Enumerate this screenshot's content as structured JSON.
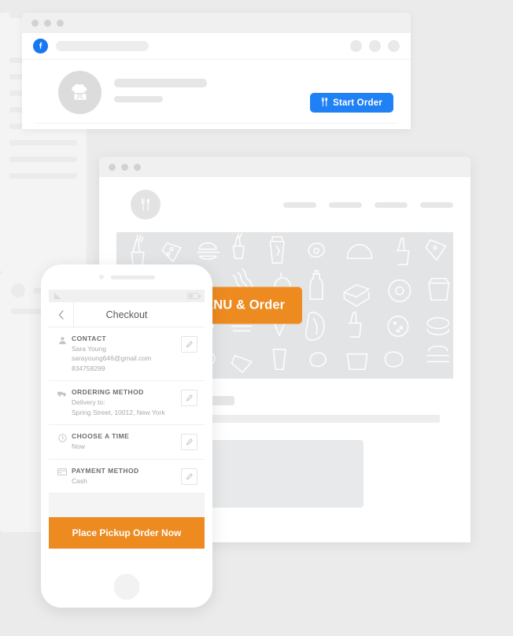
{
  "page": {
    "background_color": "#ebebeb",
    "accent_orange": "#ED8B21",
    "accent_blue": "#2080f5",
    "facebook_blue": "#1877F2"
  },
  "facebook_window": {
    "window_dots": 3,
    "logo_icon": "facebook-logo-icon",
    "search_placeholder_bar": "",
    "nav_circles": 3,
    "avatar_icon": "chef-hat-utensils-icon",
    "name_placeholder": "",
    "meta_placeholder": "",
    "start_order_label": "Start Order",
    "start_order_icon": "fork-knife-icon",
    "tabs": [
      {
        "active": true
      },
      {
        "active": false
      },
      {
        "active": false
      },
      {
        "active": false
      }
    ]
  },
  "site_window": {
    "window_dots": 3,
    "logo_icon": "fork-knife-circle-icon",
    "nav_items": 4,
    "hero": {
      "background_color": "#e2e4e6",
      "pattern": "food-doodle-pattern",
      "cta_label": "See MENU & Order"
    }
  },
  "phone": {
    "status_bar": {
      "signal_icon": "signal-icon",
      "battery_icon": "battery-icon"
    },
    "header": {
      "back_icon": "chevron-left-icon",
      "title": "Checkout"
    },
    "rows": [
      {
        "icon": "person-icon",
        "label": "CONTACT",
        "lines": [
          "Sara Young",
          "sarayoung646@gmail.com",
          "834758299"
        ],
        "edit_icon": "pencil-icon"
      },
      {
        "icon": "delivery-truck-icon",
        "label": "ORDERING METHOD",
        "lines": [
          "Delivery to:",
          "Spring Street, 10012, New York"
        ],
        "edit_icon": "pencil-icon"
      },
      {
        "icon": "clock-icon",
        "label": "CHOOSE A TIME",
        "lines": [
          "Now"
        ],
        "edit_icon": "pencil-icon"
      },
      {
        "icon": "credit-card-icon",
        "label": "PAYMENT METHOD",
        "lines": [
          "Cash"
        ],
        "edit_icon": "pencil-icon"
      }
    ],
    "submit_label": "Place Pickup Order Now",
    "home_button": "home-button"
  }
}
